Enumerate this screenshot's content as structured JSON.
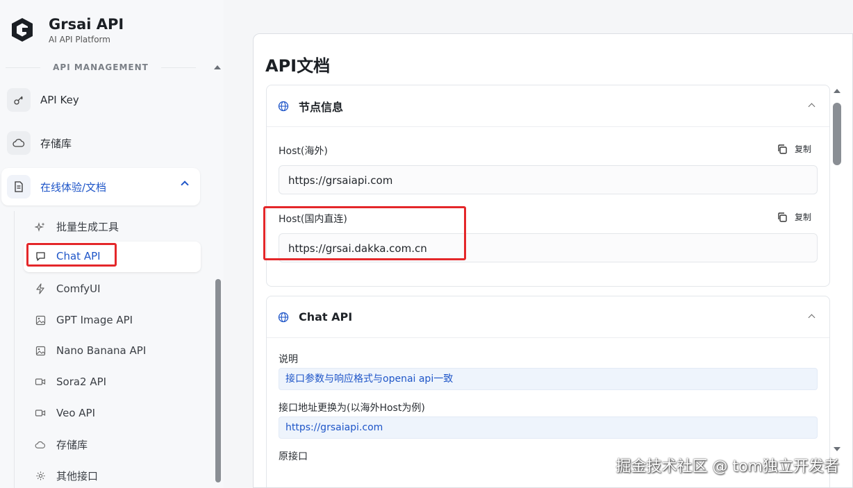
{
  "brand": {
    "name": "Grsai API",
    "subtitle": "AI API Platform"
  },
  "sidebar": {
    "section_label": "API MANAGEMENT",
    "items": [
      {
        "label": "API Key",
        "icon": "key-icon"
      },
      {
        "label": "存储库",
        "icon": "cloud-icon"
      },
      {
        "label": "在线体验/文档",
        "icon": "document-icon",
        "expanded": true
      }
    ],
    "sub_items": [
      {
        "label": "批量生成工具",
        "icon": "sparkles-icon"
      },
      {
        "label": "Chat API",
        "icon": "chat-icon",
        "selected": true
      },
      {
        "label": "ComfyUI",
        "icon": "bolt-icon"
      },
      {
        "label": "GPT Image API",
        "icon": "image-icon"
      },
      {
        "label": "Nano Banana API",
        "icon": "image-icon"
      },
      {
        "label": "Sora2 API",
        "icon": "video-icon"
      },
      {
        "label": "Veo API",
        "icon": "video-icon"
      },
      {
        "label": "存储库",
        "icon": "cloud-icon"
      },
      {
        "label": "其他接口",
        "icon": "gear-icon"
      }
    ]
  },
  "main": {
    "title": "API文档",
    "node_card": {
      "title": "节点信息",
      "fields": [
        {
          "label": "Host(海外)",
          "value": "https://grsaiapi.com",
          "copy_label": "复制"
        },
        {
          "label": "Host(国内直连)",
          "value": "https://grsai.dakka.com.cn",
          "copy_label": "复制"
        }
      ]
    },
    "chat_card": {
      "title": "Chat API",
      "desc_label": "说明",
      "desc_value": "接口参数与响应格式与openai api一致",
      "endpoint_label": "接口地址更换为(以海外Host为例)",
      "endpoint_value": "https://grsaiapi.com",
      "original_label": "原接口"
    }
  },
  "watermark": "掘金技术社区 @ tom独立开发者",
  "colors": {
    "accent": "#1e55c8",
    "highlight": "#e4272a",
    "info_bg": "#eef4fc"
  }
}
